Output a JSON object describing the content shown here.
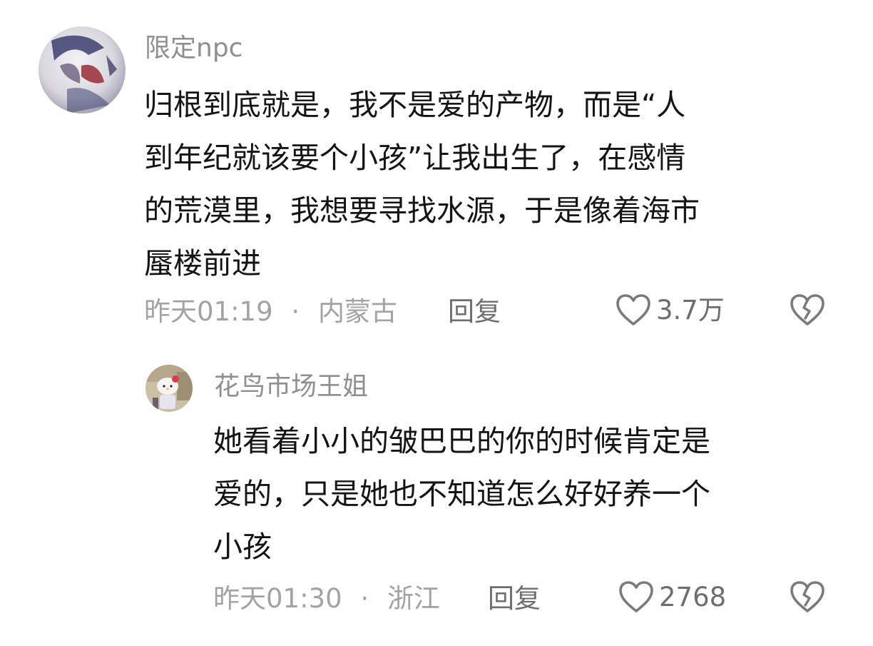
{
  "comments": [
    {
      "username": "限定npc",
      "lines": [
        "归根到底就是，我不是爱的产物，而是“人",
        "到年纪就该要个小孩”让我出生了，在感情",
        "的荒漠里，我想要寻找水源，于是像着海市",
        "蜃楼前进"
      ],
      "time": "昨天01:19",
      "separator": "·",
      "location": "内蒙古",
      "reply_label": "回复",
      "like_count": "3.7万",
      "like_icon": "heart-outline-icon",
      "dislike_icon": "broken-heart-icon"
    }
  ],
  "replies": [
    {
      "username": "花鸟市场王姐",
      "lines": [
        "她看着小小的皱巴巴的你的时候肯定是",
        "爱的，只是她也不知道怎么好好养一个",
        "小孩"
      ],
      "time": "昨天01:30",
      "separator": "·",
      "location": "浙江",
      "reply_label": "回复",
      "like_count": "2768",
      "like_icon": "heart-outline-icon",
      "dislike_icon": "broken-heart-icon"
    }
  ],
  "colors": {
    "username": "#8f8f8f",
    "content": "#141414",
    "meta": "#a3a3a3",
    "action": "#6e6e6e"
  }
}
